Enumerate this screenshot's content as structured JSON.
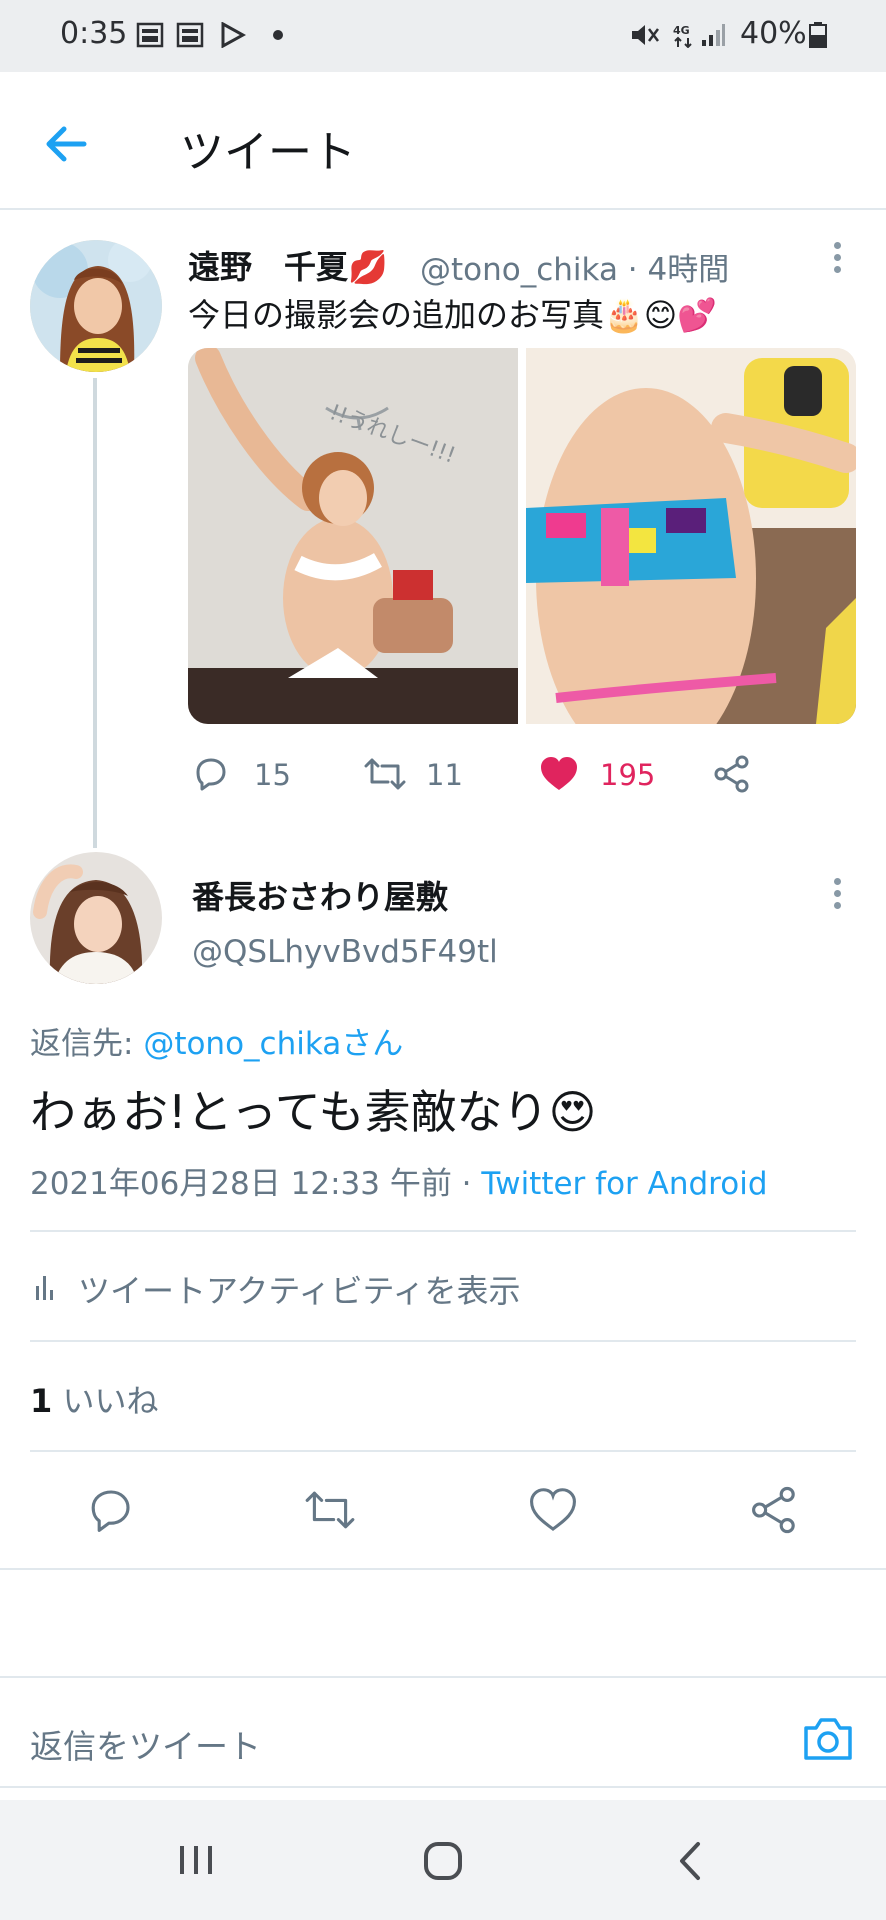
{
  "status_bar": {
    "time": "0:35",
    "battery_percent": "40%",
    "icons": [
      "life-app-icon",
      "life-app-icon",
      "play-store-icon",
      "dot-icon",
      "mute-icon",
      "4g-icon",
      "signal-icon",
      "battery-icon"
    ]
  },
  "header": {
    "title": "ツイート",
    "back_icon": "arrow-left-icon"
  },
  "original_tweet": {
    "author_name": "遠野　千夏💋",
    "handle_time": "@tono_chika · 4時間",
    "text": "今日の撮影会の追加のお写真🎂😊💕",
    "photos": [
      "photo-1",
      "photo-2"
    ],
    "photo1_caption": "!!うれしー!!!",
    "replies": "15",
    "retweets": "11",
    "likes": "195",
    "liked": true
  },
  "reply_tweet": {
    "author_name": "番長おさわり屋敷",
    "handle": "@QSLhyvBvd5F49tl",
    "reply_to_prefix": "返信先: ",
    "reply_to_link": "@tono_chikaさん",
    "text": "わぁお!とっても素敵なり😍",
    "datetime": "2021年06月28日 12:33 午前 · ",
    "source": "Twitter for Android",
    "activity_label": "ツイートアクティビティを表示",
    "likes_count": "1",
    "likes_label": " いいね"
  },
  "composer": {
    "placeholder": "返信をツイート"
  },
  "colors": {
    "accent": "#1da1f2",
    "like": "#e0245e",
    "secondary_text": "#657786",
    "divider": "#e1e8ed"
  }
}
